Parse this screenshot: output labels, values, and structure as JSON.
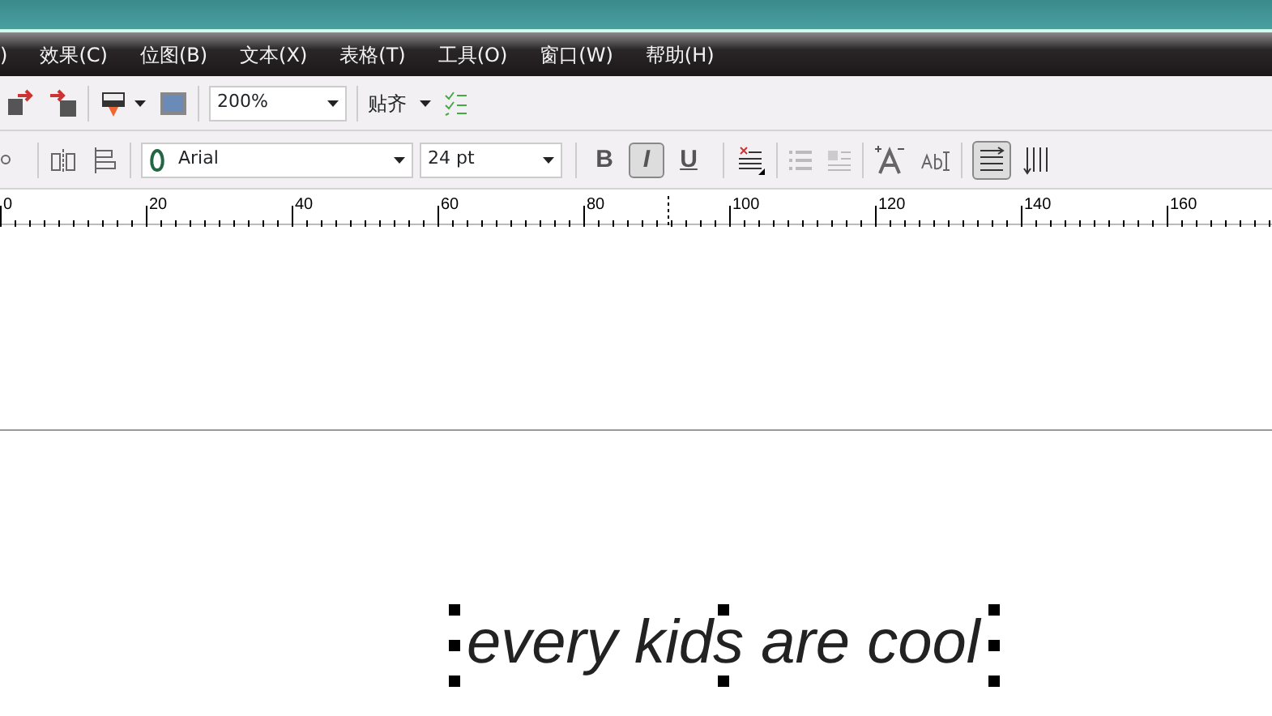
{
  "menu_bar": {
    "items": [
      ")",
      "效果(C)",
      "位图(B)",
      "文本(X)",
      "表格(T)",
      "工具(O)",
      "窗口(W)",
      "帮助(H)"
    ]
  },
  "standard_toolbar": {
    "zoom": "200%",
    "snap": "贴齐"
  },
  "text_toolbar": {
    "font": "Arial",
    "font_size": "24 pt",
    "styles": [
      {
        "label": "B",
        "kind": "bold",
        "selected": false
      },
      {
        "label": "I",
        "kind": "italic",
        "selected": true
      },
      {
        "label": "U",
        "kind": "underline",
        "selected": false
      }
    ],
    "orientation": [
      {
        "kind": "horizontal",
        "selected": true
      },
      {
        "kind": "vertical",
        "selected": false
      }
    ]
  },
  "ruler": {
    "labels": [
      "0",
      "20",
      "40",
      "60",
      "80",
      "100",
      "120",
      "140",
      "160"
    ]
  },
  "canvas": {
    "text": "every kids are cool"
  }
}
